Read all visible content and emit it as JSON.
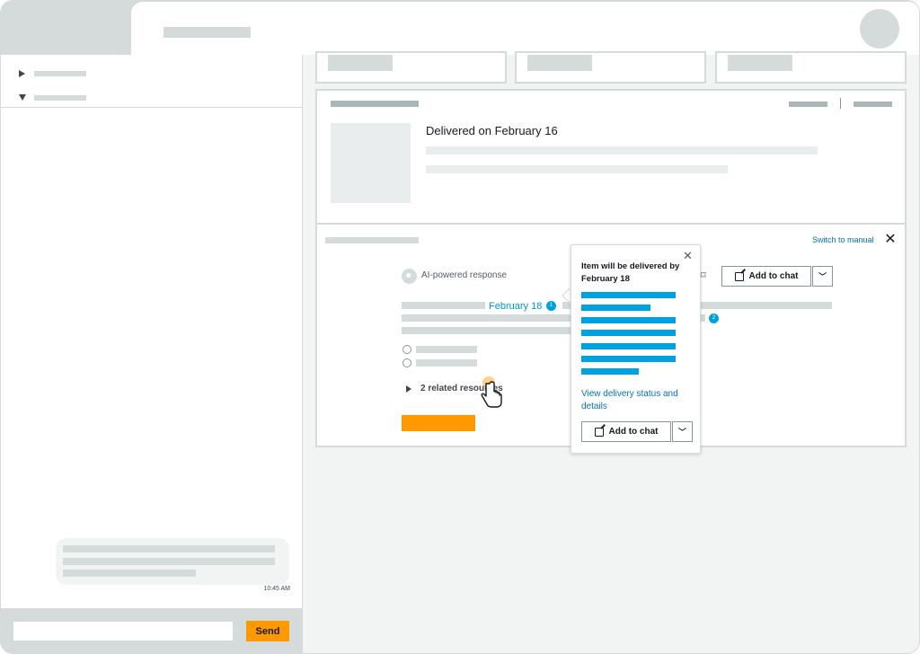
{
  "chat": {
    "timestamp": "10:45 AM",
    "input_placeholder": "",
    "send_label": "Send"
  },
  "order": {
    "delivered_title": "Delivered on February 16"
  },
  "assistant": {
    "switch_label": "Switch to manual",
    "close_icon": "✕",
    "ai_label": "AI-powered response",
    "add_to_chat": "Add to chat",
    "inline_date": "February 18",
    "citation_1": "1",
    "citation_2": "2",
    "related_label": "2 related resources"
  },
  "popover": {
    "title": "Item will be delivered by February 18",
    "link": "View delivery status and details",
    "add_to_chat": "Add to chat",
    "close_icon": "✕"
  },
  "colors": {
    "accent_orange": "#ff9900",
    "link_blue": "#0073bb",
    "citation_blue": "#00a1e0",
    "placeholder_gray": "#d5dbdb"
  }
}
